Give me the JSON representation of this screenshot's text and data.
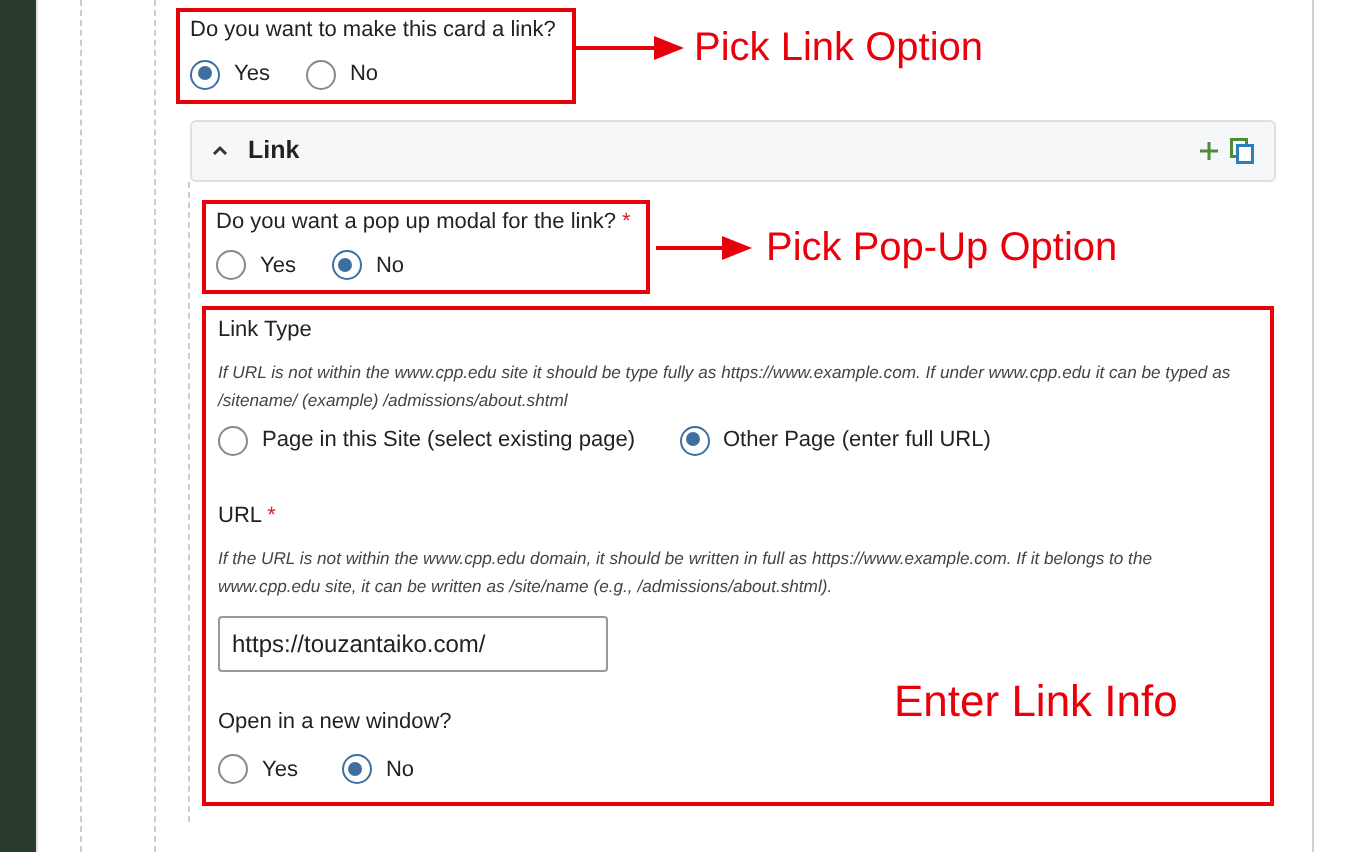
{
  "card_link": {
    "question": "Do you want to make this card a link?",
    "options": [
      {
        "label": "Yes",
        "selected": true
      },
      {
        "label": "No",
        "selected": false
      }
    ]
  },
  "section": {
    "title": "Link",
    "expanded": true
  },
  "popup": {
    "question": "Do you want a pop up modal for the link?",
    "required_mark": "*",
    "options": [
      {
        "label": "Yes",
        "selected": false
      },
      {
        "label": "No",
        "selected": true
      }
    ]
  },
  "link_type": {
    "label": "Link Type",
    "hint": "If URL is not within the www.cpp.edu site it should be type fully as https://www.example.com. If under www.cpp.edu it can be typed as /sitename/ (example) /admissions/about.shtml",
    "options": [
      {
        "label": "Page in this Site (select existing page)",
        "selected": false
      },
      {
        "label": "Other Page (enter full URL)",
        "selected": true
      }
    ]
  },
  "url": {
    "label": "URL",
    "required_mark": "*",
    "hint": "If the URL is not within the www.cpp.edu domain, it should be written in full as https://www.example.com. If it belongs to the www.cpp.edu site, it can be written as /site/name (e.g., /admissions/about.shtml).",
    "value": "https://touzantaiko.com/"
  },
  "new_window": {
    "question": "Open in a new window?",
    "options": [
      {
        "label": "Yes",
        "selected": false
      },
      {
        "label": "No",
        "selected": true
      }
    ]
  },
  "annotations": [
    {
      "text": "Pick Link Option"
    },
    {
      "text": "Pick Pop-Up Option"
    },
    {
      "text": "Enter Link Info"
    }
  ]
}
